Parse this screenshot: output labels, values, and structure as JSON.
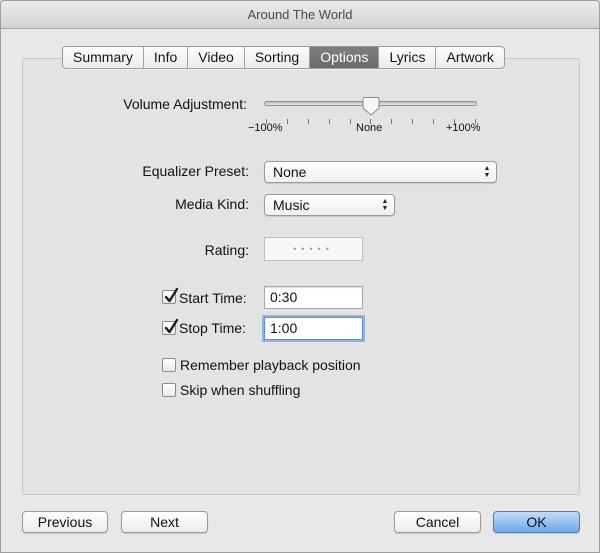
{
  "window": {
    "title": "Around The World"
  },
  "tabs": [
    {
      "label": "Summary"
    },
    {
      "label": "Info"
    },
    {
      "label": "Video"
    },
    {
      "label": "Sorting"
    },
    {
      "label": "Options",
      "active": true
    },
    {
      "label": "Lyrics"
    },
    {
      "label": "Artwork"
    }
  ],
  "volume": {
    "label": "Volume Adjustment:",
    "min_label": "−100%",
    "mid_label": "None",
    "max_label": "+100%",
    "value_percent": 0
  },
  "equalizer": {
    "label": "Equalizer Preset:",
    "value": "None"
  },
  "media_kind": {
    "label": "Media Kind:",
    "value": "Music"
  },
  "rating": {
    "label": "Rating:",
    "stars": 0,
    "placeholder_dots": "•••••"
  },
  "start_time": {
    "label": "Start Time:",
    "checked": true,
    "value": "0:30"
  },
  "stop_time": {
    "label": "Stop Time:",
    "checked": true,
    "value": "1:00"
  },
  "remember_playback": {
    "label": "Remember playback position",
    "checked": false
  },
  "skip_shuffle": {
    "label": "Skip when shuffling",
    "checked": false
  },
  "buttons": {
    "previous": "Previous",
    "next": "Next",
    "cancel": "Cancel",
    "ok": "OK"
  },
  "colors": {
    "active_tab": "#707070",
    "default_button": "#6fa8e8",
    "focus_ring": "#8db4ea"
  }
}
